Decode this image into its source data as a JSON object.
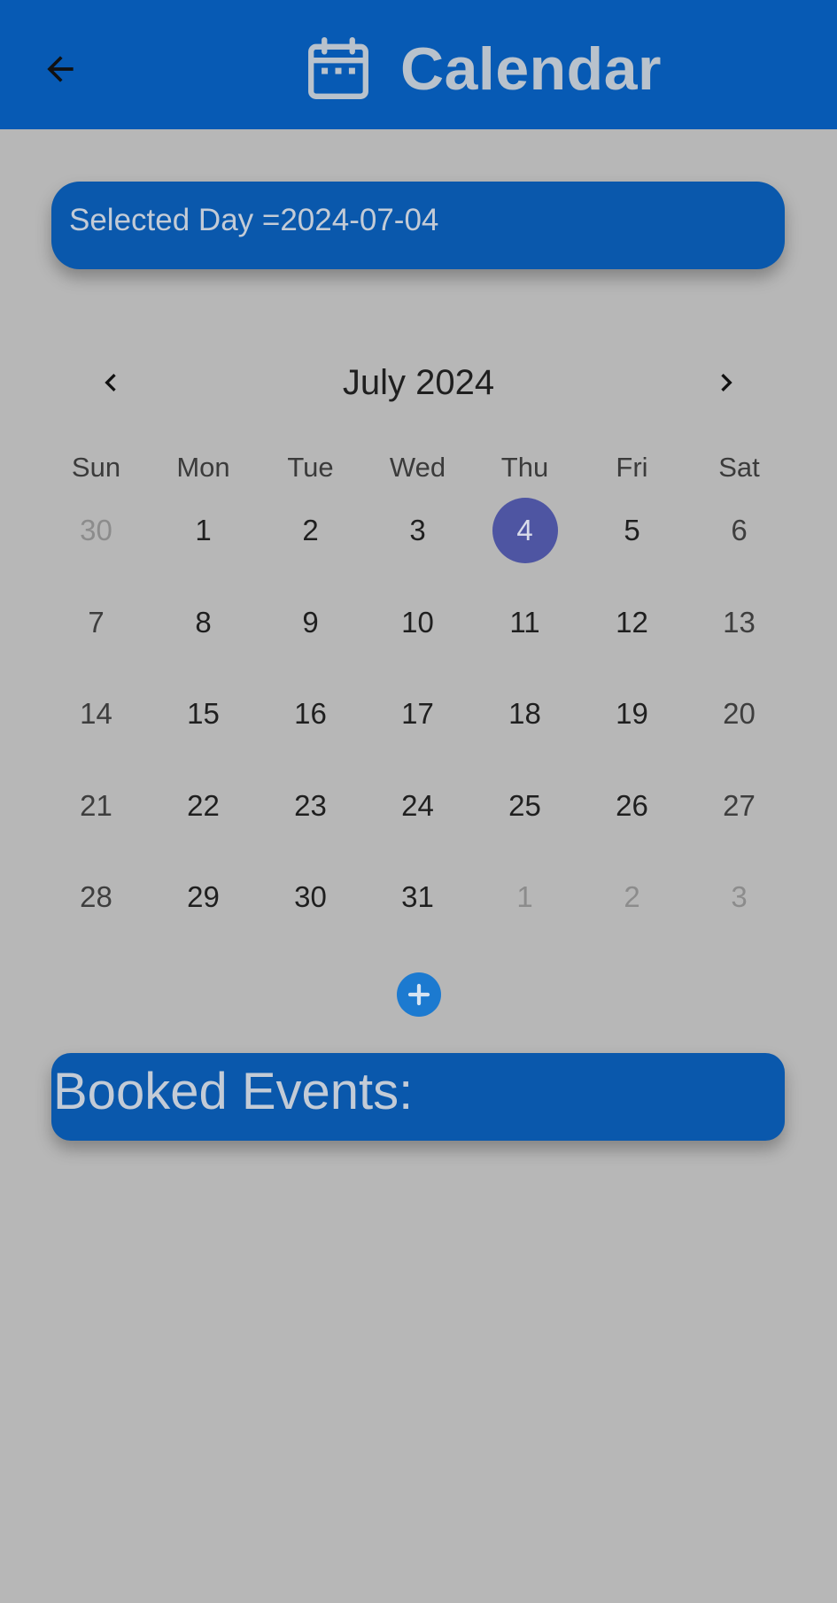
{
  "appbar": {
    "title": "Calendar",
    "back_icon": "arrow-left-icon",
    "title_icon": "calendar-icon",
    "color": "#075ab4"
  },
  "selected": {
    "text": "Selected Day =2024-07-04"
  },
  "calendar": {
    "month_title": "July 2024",
    "prev_icon": "chevron-left-icon",
    "next_icon": "chevron-right-icon",
    "weekdays": [
      "Sun",
      "Mon",
      "Tue",
      "Wed",
      "Thu",
      "Fri",
      "Sat"
    ],
    "weeks": [
      [
        {
          "d": "30",
          "out": true
        },
        {
          "d": "1"
        },
        {
          "d": "2"
        },
        {
          "d": "3"
        },
        {
          "d": "4",
          "selected": true
        },
        {
          "d": "5"
        },
        {
          "d": "6"
        }
      ],
      [
        {
          "d": "7"
        },
        {
          "d": "8"
        },
        {
          "d": "9"
        },
        {
          "d": "10"
        },
        {
          "d": "11"
        },
        {
          "d": "12"
        },
        {
          "d": "13"
        }
      ],
      [
        {
          "d": "14"
        },
        {
          "d": "15"
        },
        {
          "d": "16"
        },
        {
          "d": "17"
        },
        {
          "d": "18"
        },
        {
          "d": "19"
        },
        {
          "d": "20"
        }
      ],
      [
        {
          "d": "21"
        },
        {
          "d": "22"
        },
        {
          "d": "23"
        },
        {
          "d": "24"
        },
        {
          "d": "25"
        },
        {
          "d": "26"
        },
        {
          "d": "27"
        }
      ],
      [
        {
          "d": "28"
        },
        {
          "d": "29"
        },
        {
          "d": "30"
        },
        {
          "d": "31"
        },
        {
          "d": "1",
          "out": true
        },
        {
          "d": "2",
          "out": true
        },
        {
          "d": "3",
          "out": true
        }
      ]
    ],
    "selected_color": "#4e55a2"
  },
  "add_button": {
    "icon": "plus-circle-icon"
  },
  "events": {
    "heading": "Booked Events:"
  }
}
